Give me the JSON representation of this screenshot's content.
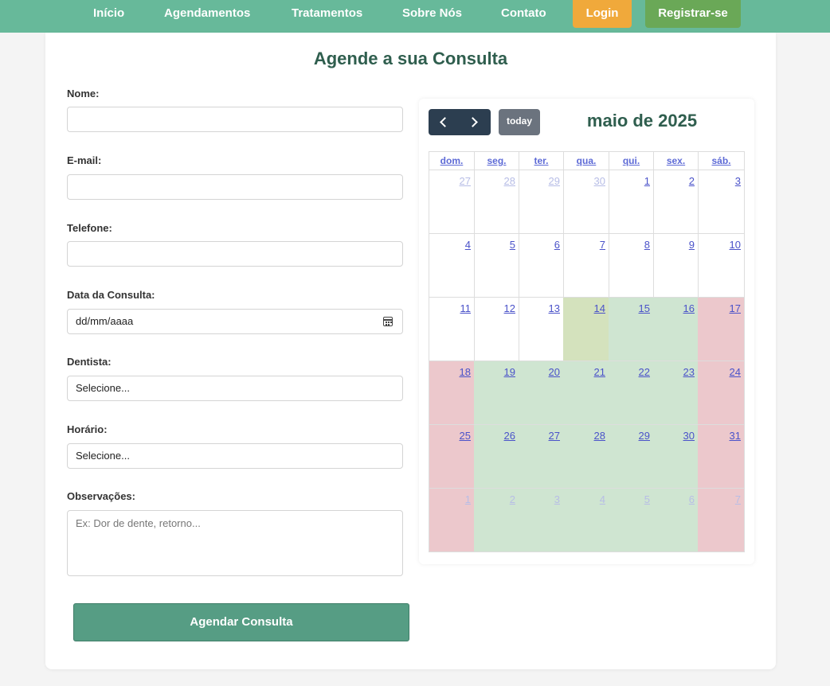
{
  "nav": {
    "links": [
      "Início",
      "Agendamentos",
      "Tratamentos",
      "Sobre Nós",
      "Contato"
    ],
    "login_label": "Login",
    "register_label": "Registrar-se"
  },
  "page": {
    "title": "Agende a sua Consulta"
  },
  "form": {
    "name_label": "Nome:",
    "email_label": "E-mail:",
    "phone_label": "Telefone:",
    "date_label": "Data da Consulta:",
    "date_value": "dd/mm/aaaa",
    "dentist_label": "Dentista:",
    "dentist_value": "Selecione...",
    "time_label": "Horário:",
    "time_value": "Selecione...",
    "notes_label": "Observações:",
    "notes_placeholder": "Ex: Dor de dente, retorno...",
    "submit_label": "Agendar Consulta"
  },
  "calendar": {
    "title": "maio de 2025",
    "today_label": "today",
    "weekdays": [
      "dom.",
      "seg.",
      "ter.",
      "qua.",
      "qui.",
      "sex.",
      "sáb."
    ],
    "weeks": [
      [
        {
          "d": "27",
          "s": "other"
        },
        {
          "d": "28",
          "s": "other"
        },
        {
          "d": "29",
          "s": "other"
        },
        {
          "d": "30",
          "s": "other"
        },
        {
          "d": "1",
          "s": ""
        },
        {
          "d": "2",
          "s": ""
        },
        {
          "d": "3",
          "s": ""
        }
      ],
      [
        {
          "d": "4",
          "s": ""
        },
        {
          "d": "5",
          "s": ""
        },
        {
          "d": "6",
          "s": ""
        },
        {
          "d": "7",
          "s": ""
        },
        {
          "d": "8",
          "s": ""
        },
        {
          "d": "9",
          "s": ""
        },
        {
          "d": "10",
          "s": ""
        }
      ],
      [
        {
          "d": "11",
          "s": ""
        },
        {
          "d": "12",
          "s": ""
        },
        {
          "d": "13",
          "s": ""
        },
        {
          "d": "14",
          "s": "today"
        },
        {
          "d": "15",
          "s": "avail"
        },
        {
          "d": "16",
          "s": "avail"
        },
        {
          "d": "17",
          "s": "closed"
        }
      ],
      [
        {
          "d": "18",
          "s": "closed"
        },
        {
          "d": "19",
          "s": "avail"
        },
        {
          "d": "20",
          "s": "avail"
        },
        {
          "d": "21",
          "s": "avail"
        },
        {
          "d": "22",
          "s": "avail"
        },
        {
          "d": "23",
          "s": "avail"
        },
        {
          "d": "24",
          "s": "closed"
        }
      ],
      [
        {
          "d": "25",
          "s": "closed"
        },
        {
          "d": "26",
          "s": "avail"
        },
        {
          "d": "27",
          "s": "avail"
        },
        {
          "d": "28",
          "s": "avail"
        },
        {
          "d": "29",
          "s": "avail"
        },
        {
          "d": "30",
          "s": "avail"
        },
        {
          "d": "31",
          "s": "closed"
        }
      ],
      [
        {
          "d": "1",
          "s": "other closed"
        },
        {
          "d": "2",
          "s": "other avail"
        },
        {
          "d": "3",
          "s": "other avail"
        },
        {
          "d": "4",
          "s": "other avail"
        },
        {
          "d": "5",
          "s": "other avail"
        },
        {
          "d": "6",
          "s": "other avail"
        },
        {
          "d": "7",
          "s": "other closed"
        }
      ]
    ]
  },
  "colors": {
    "navbar": "#67b99a",
    "login": "#f0a93b",
    "register": "#6aa857",
    "submit": "#569d84",
    "available_day": "#cfe5d1",
    "unavailable_day": "#ecc8cc",
    "today_day": "#d4e2bd"
  },
  "icons": [
    "chevron-left-icon",
    "chevron-right-icon",
    "calendar-icon"
  ]
}
